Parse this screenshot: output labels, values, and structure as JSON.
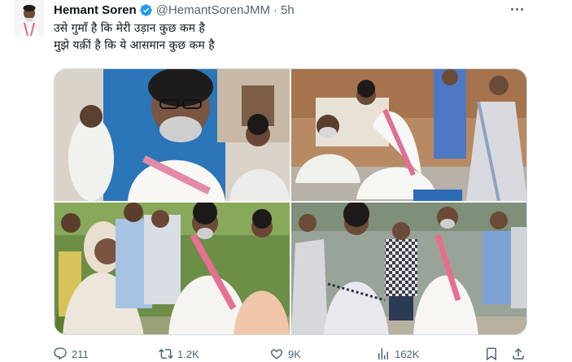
{
  "tweet": {
    "author_name": "Hemant Soren",
    "handle": "@HemantSorenJMM",
    "separator": "·",
    "time": "5h",
    "text_lines": [
      "उसे गुमाँ है कि मेरी उड़ान कुछ कम है",
      "मुझे यक़ीं है कि ये आसमान कुछ कम है"
    ],
    "verified_color": "#1d9bf0"
  },
  "photos": [
    {
      "label": "photo-1"
    },
    {
      "label": "photo-2"
    },
    {
      "label": "photo-3"
    },
    {
      "label": "photo-4"
    }
  ],
  "stats": {
    "replies": "211",
    "retweets": "1.2K",
    "likes": "9K",
    "views": "162K"
  },
  "icons": {
    "reply": "reply-icon",
    "retweet": "retweet-icon",
    "like": "heart-icon",
    "views": "views-chart-icon",
    "bookmark": "bookmark-icon",
    "share": "share-icon",
    "more": "more-options-icon"
  }
}
